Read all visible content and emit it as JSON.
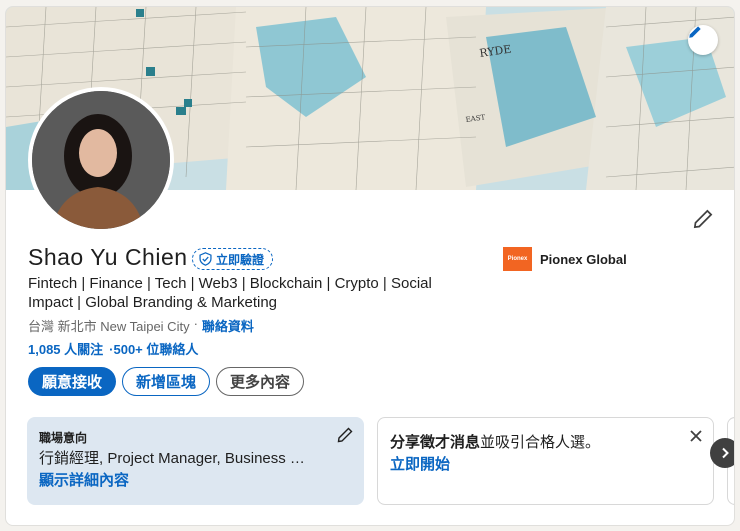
{
  "profile": {
    "name": "Shao Yu Chien",
    "verify_label": "立即驗證",
    "headline": "Fintech | Finance | Tech | Web3 | Blockchain | Crypto | Social Impact | Global Branding & Marketing",
    "location": "台灣 新北市 New Taipei City",
    "separator": "·",
    "contact_link": "聯絡資料",
    "followers": "1,085 人關注",
    "connections": "·500+ 位聯絡人",
    "company_name": "Pionex Global",
    "company_logo_text": "Pionex"
  },
  "actions": {
    "open_to": "願意接收",
    "add_section": "新增區塊",
    "more": "更多內容"
  },
  "open_to_work": {
    "title": "職場意向",
    "description": "行銷經理, Project Manager, Business …",
    "link": "顯示詳細內容"
  },
  "hiring": {
    "bold_text": "分享徵才消息",
    "rest_text": "並吸引合格人選。",
    "link": "立即開始"
  },
  "icons": {
    "cover_edit": "pencil-icon",
    "profile_edit": "pencil-icon",
    "verify": "shield-check-icon",
    "close": "close-icon",
    "next": "chevron-right-icon"
  },
  "colors": {
    "accent": "#0a66c2",
    "otw_bg": "#dde7f1",
    "pionex": "#f26522"
  }
}
